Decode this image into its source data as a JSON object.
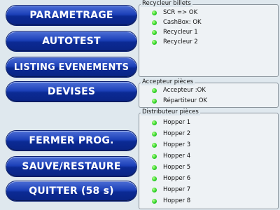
{
  "buttons": [
    {
      "label": "PARAMETRAGE"
    },
    {
      "label": "AUTOTEST"
    },
    {
      "label": "LISTING EVENEMENTS"
    },
    {
      "label": "DEVISES"
    },
    {
      "label": "FERMER PROG."
    },
    {
      "label": "SAUVE/RESTAURE"
    },
    {
      "label": "QUITTER (58 s)"
    }
  ],
  "recycleur": {
    "title": "Recycleur billets",
    "items": [
      {
        "label": "SCR => OK",
        "status": "green"
      },
      {
        "label": "CashBox:  OK",
        "status": "green"
      },
      {
        "label": "Recycleur 1",
        "status": "green"
      },
      {
        "label": "Recycleur 2",
        "status": "green"
      }
    ]
  },
  "accepteur": {
    "title": "Accepteur pièces",
    "items": [
      {
        "label": "Accepteur :OK",
        "status": "green"
      },
      {
        "label": "Répartiteur OK",
        "status": "green"
      }
    ]
  },
  "distributeur": {
    "title": "Distributeur pièces",
    "items": [
      {
        "label": "Hopper 1",
        "status": "green"
      },
      {
        "label": "Hopper 2",
        "status": "green"
      },
      {
        "label": "Hopper 3",
        "status": "green"
      },
      {
        "label": "Hopper 4",
        "status": "green"
      },
      {
        "label": "Hopper 5",
        "status": "green"
      },
      {
        "label": "Hopper 6",
        "status": "green"
      },
      {
        "label": "Hopper 7",
        "status": "green"
      },
      {
        "label": "Hopper 8",
        "status": "green"
      }
    ]
  },
  "colors": {
    "led_ok": "#33d62c",
    "button": "#1c40b8"
  }
}
